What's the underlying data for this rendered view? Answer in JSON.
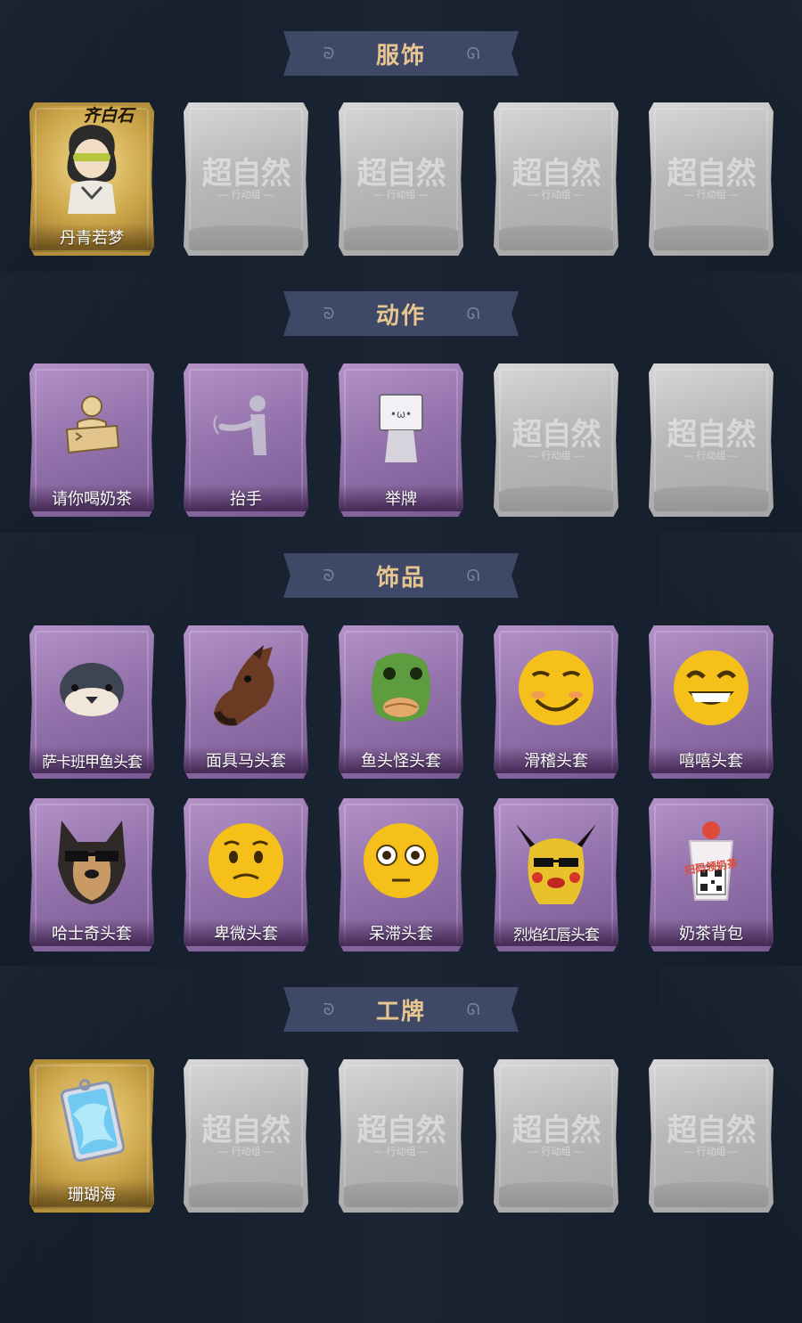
{
  "sections": [
    {
      "title": "服饰",
      "cards": [
        {
          "state": "gold",
          "label": "丹青若梦",
          "icon": "character-portrait-icon",
          "badge": "齐白石"
        },
        {
          "state": "locked"
        },
        {
          "state": "locked"
        },
        {
          "state": "locked"
        },
        {
          "state": "locked"
        }
      ]
    },
    {
      "title": "动作",
      "cards": [
        {
          "state": "purple",
          "label": "请你喝奶茶",
          "icon": "offer-sign-pose-icon"
        },
        {
          "state": "purple",
          "label": "抬手",
          "icon": "raise-hand-pose-icon"
        },
        {
          "state": "purple",
          "label": "举牌",
          "icon": "hold-sign-pose-icon"
        },
        {
          "state": "locked"
        },
        {
          "state": "locked"
        }
      ]
    },
    {
      "title": "饰品",
      "cards": [
        {
          "state": "purple",
          "label": "萨卡班甲鱼头套",
          "icon": "fish-head-mask-icon"
        },
        {
          "state": "purple",
          "label": "面具马头套",
          "icon": "horse-head-mask-icon"
        },
        {
          "state": "purple",
          "label": "鱼头怪头套",
          "icon": "green-fish-mask-icon"
        },
        {
          "state": "purple",
          "label": "滑稽头套",
          "icon": "smirk-emoji-mask-icon"
        },
        {
          "state": "purple",
          "label": "嘻嘻头套",
          "icon": "grin-emoji-mask-icon"
        },
        {
          "state": "purple",
          "label": "哈士奇头套",
          "icon": "husky-mask-icon"
        },
        {
          "state": "purple",
          "label": "卑微头套",
          "icon": "pleading-emoji-mask-icon"
        },
        {
          "state": "purple",
          "label": "呆滞头套",
          "icon": "dazed-emoji-mask-icon"
        },
        {
          "state": "purple",
          "label": "烈焰红唇头套",
          "icon": "pikachu-mask-icon"
        },
        {
          "state": "purple",
          "label": "奶茶背包",
          "icon": "milk-tea-backpack-icon"
        }
      ]
    },
    {
      "title": "工牌",
      "cards": [
        {
          "state": "gold",
          "label": "珊瑚海",
          "icon": "coral-badge-icon"
        },
        {
          "state": "locked"
        },
        {
          "state": "locked"
        },
        {
          "state": "locked"
        },
        {
          "state": "locked"
        }
      ]
    }
  ],
  "locked_watermark": {
    "title": "超自然",
    "subtitle": "— 行动组 —"
  },
  "qr_caption": "扫码领奶茶",
  "colors": {
    "background": "#101824",
    "header_bg": "#3f4867",
    "header_text": "#e8c690",
    "gold_card": "#c9a246",
    "purple_card": "#9574ad",
    "locked_card": "#b8b8b8"
  }
}
